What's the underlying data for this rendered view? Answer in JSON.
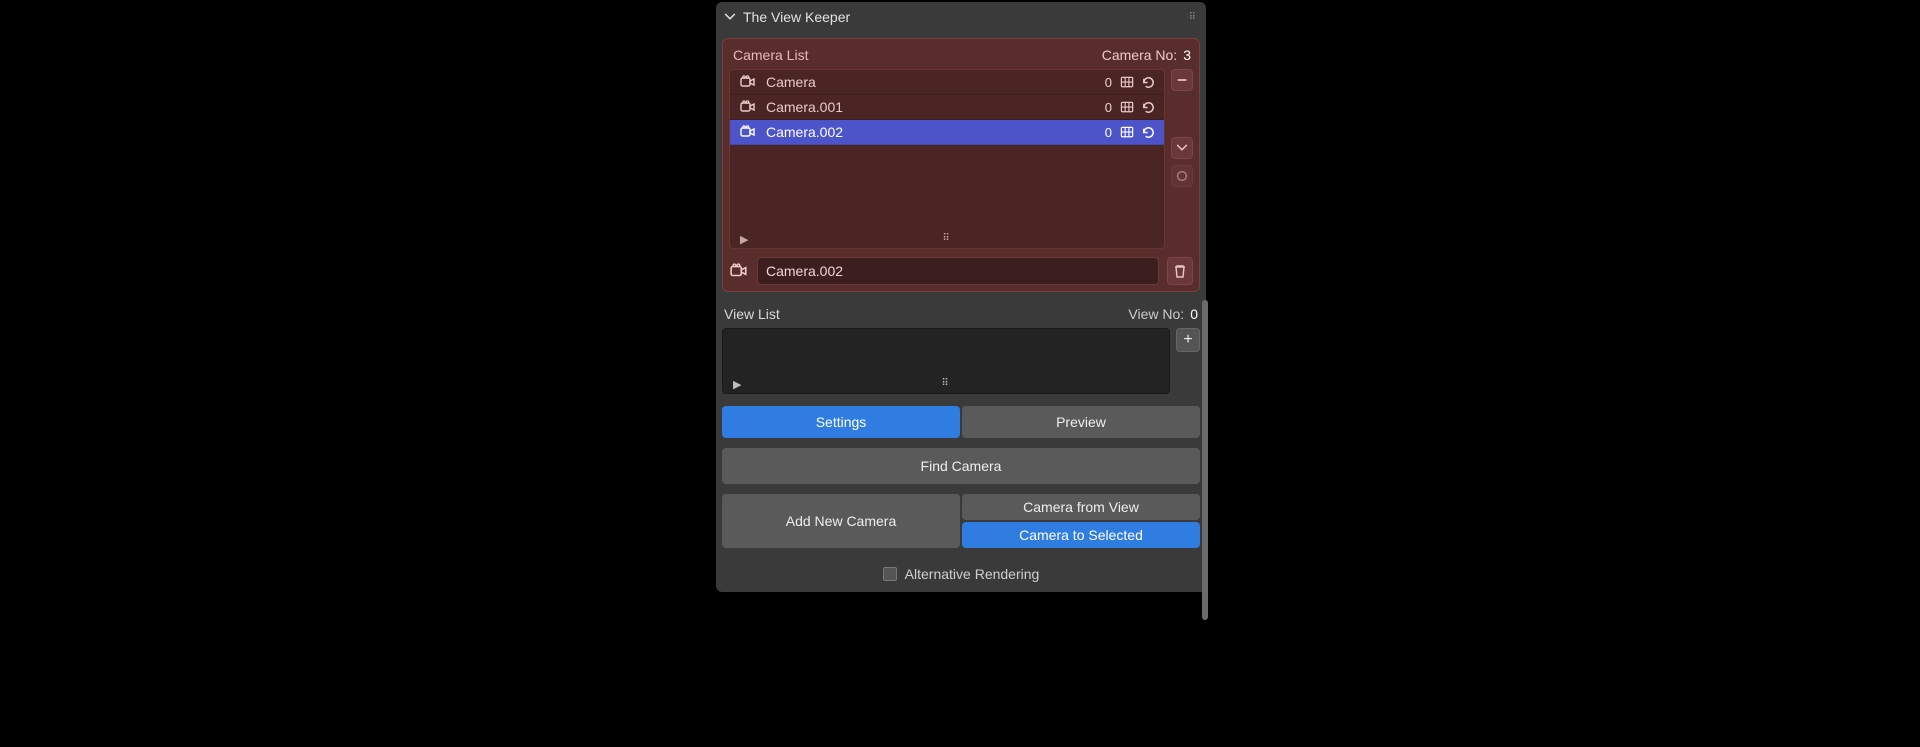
{
  "header": {
    "title": "The View Keeper"
  },
  "camera_section": {
    "title": "Camera List",
    "count_label": "Camera No:",
    "count": "3",
    "rows": [
      {
        "name": "Camera",
        "value": "0"
      },
      {
        "name": "Camera.001",
        "value": "0"
      },
      {
        "name": "Camera.002",
        "value": "0"
      }
    ],
    "selected_name": "Camera.002"
  },
  "view_section": {
    "title": "View List",
    "count_label": "View No:",
    "count": "0"
  },
  "tabs": {
    "settings": "Settings",
    "preview": "Preview"
  },
  "buttons": {
    "find": "Find Camera",
    "add_new": "Add New Camera",
    "from_view": "Camera from View",
    "to_selected": "Camera to Selected"
  },
  "alt_render": {
    "label": "Alternative Rendering"
  }
}
